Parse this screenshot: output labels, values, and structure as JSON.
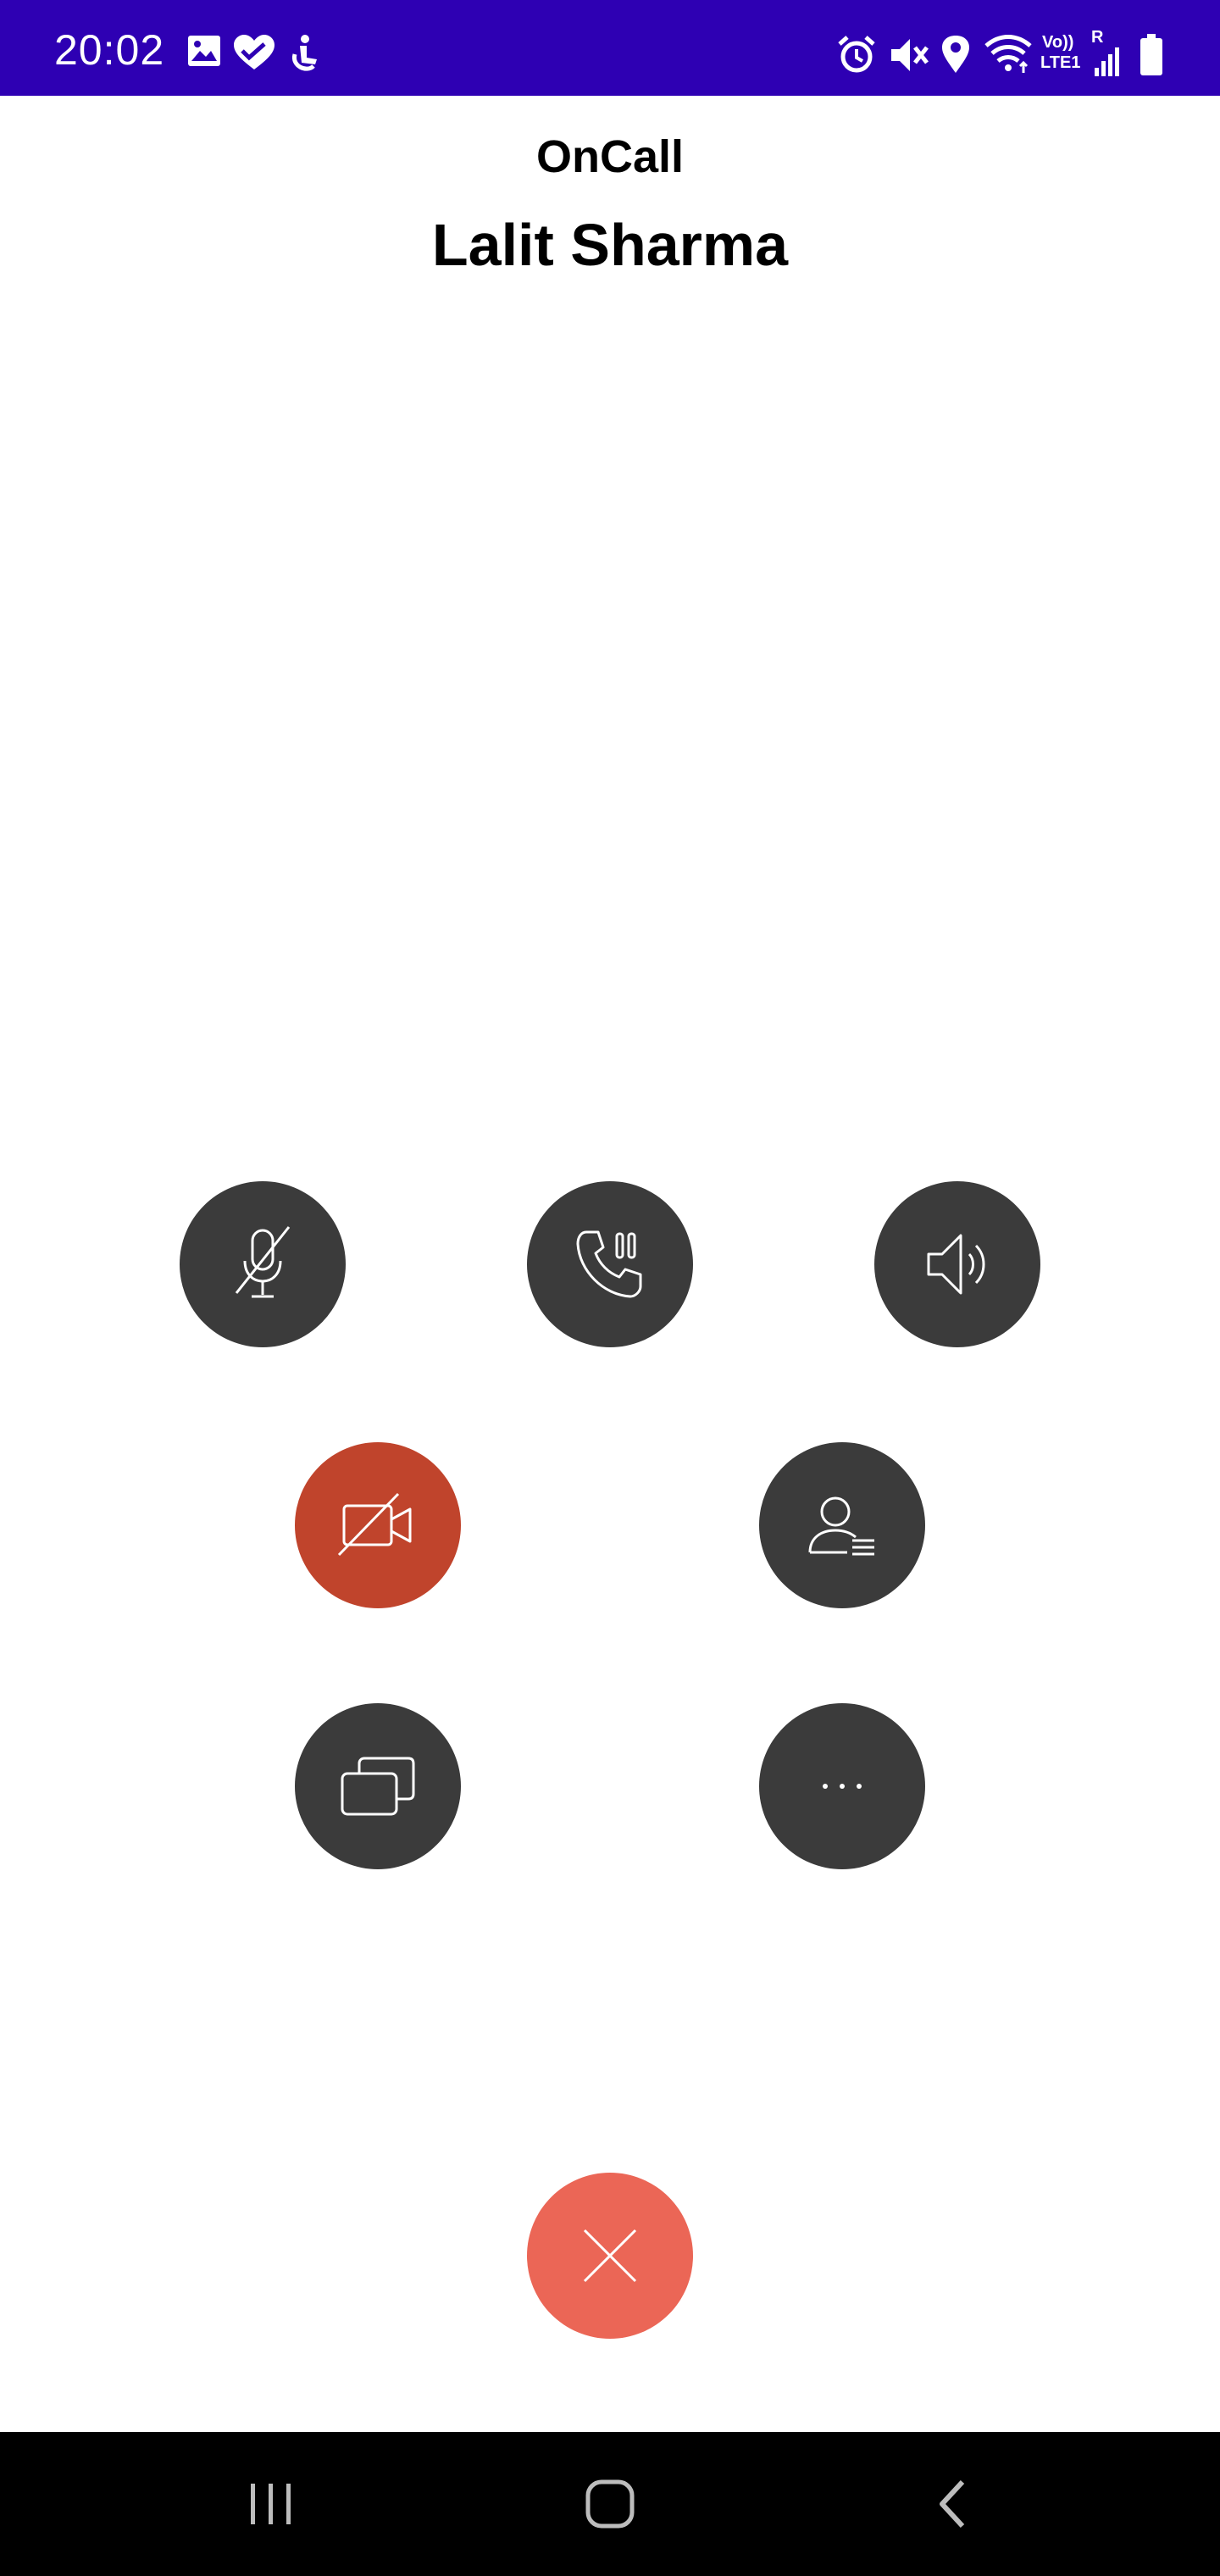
{
  "status_bar": {
    "time": "20:02",
    "left_icons": [
      "gallery-icon",
      "health-heart-icon",
      "accessibility-icon"
    ],
    "right_icons": [
      "alarm-icon",
      "vibrate-mute-icon",
      "location-icon",
      "wifi-icon",
      "volte-lte-signal-icon",
      "battery-icon"
    ],
    "volte_label": "Vo))",
    "lte_label": "LTE1",
    "roaming_label": "R",
    "background_color": "#2e00b3"
  },
  "call": {
    "app_title": "OnCall",
    "contact_name": "Lalit Sharma"
  },
  "controls": {
    "row1": [
      "mute-microphone",
      "hold-call",
      "speaker"
    ],
    "row2": [
      "video-off",
      "contact-details"
    ],
    "row3": [
      "switch-call",
      "more-options"
    ],
    "active_color": "#c0442c",
    "button_color": "#3b3b3b",
    "end_call_color": "#eb6656"
  },
  "nav_bar": {
    "buttons": [
      "recent-apps",
      "home",
      "back"
    ]
  }
}
